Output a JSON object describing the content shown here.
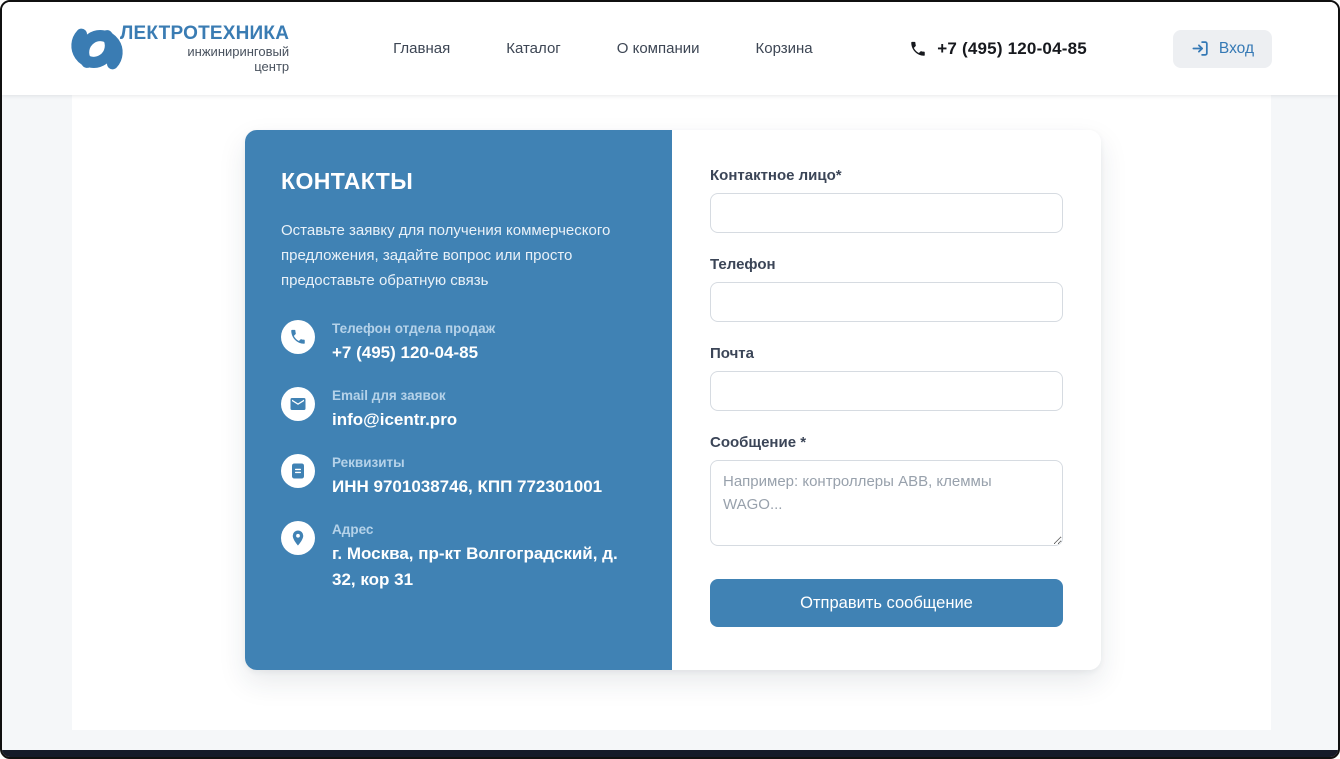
{
  "header": {
    "logo": {
      "brand_bold": "ЛЕКТРОТЕХНИКА",
      "subtitle_line1": "инжиниринговый",
      "subtitle_line2": "центр"
    },
    "nav": [
      {
        "label": "Главная"
      },
      {
        "label": "Каталог"
      },
      {
        "label": "О компании"
      },
      {
        "label": "Корзина"
      }
    ],
    "phone": "+7 (495) 120-04-85",
    "login_label": "Вход"
  },
  "contacts_panel": {
    "title": "КОНТАКТЫ",
    "description": "Оставьте заявку для получения коммерческого предложения, задайте вопрос или просто предоставьте обратную связь",
    "items": [
      {
        "icon": "phone-icon",
        "label": "Телефон отдела продаж",
        "value": "+7 (495) 120-04-85"
      },
      {
        "icon": "email-icon",
        "label": "Email для заявок",
        "value": "info@icentr.pro"
      },
      {
        "icon": "document-icon",
        "label": "Реквизиты",
        "value": "ИНН 9701038746, КПП 772301001"
      },
      {
        "icon": "location-icon",
        "label": "Адрес",
        "value": "г. Москва, пр-кт Волгоградский, д. 32, кор 31"
      }
    ]
  },
  "form": {
    "fields": [
      {
        "label": "Контактное лицо*",
        "type": "input",
        "value": "",
        "placeholder": ""
      },
      {
        "label": "Телефон",
        "type": "input",
        "value": "",
        "placeholder": ""
      },
      {
        "label": "Почта",
        "type": "input",
        "value": "",
        "placeholder": ""
      },
      {
        "label": "Сообщение *",
        "type": "textarea",
        "value": "",
        "placeholder": "Например: контроллеры ABB, клеммы WAGO..."
      }
    ],
    "submit_label": "Отправить сообщение"
  },
  "colors": {
    "brand_blue": "#3a7cb3",
    "panel_blue": "#4082b4",
    "link_blue": "#3579b5",
    "light_label_blue": "#b5d2e9",
    "footer_dark": "#151a28"
  }
}
